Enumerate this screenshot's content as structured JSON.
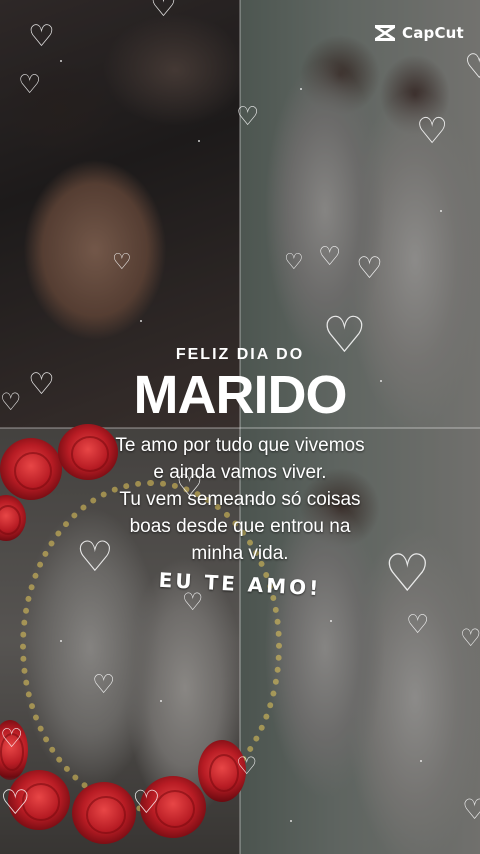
{
  "watermark": {
    "text": "CapCut",
    "icon": "capcut-logo-icon"
  },
  "title": {
    "line1": "FELIZ DIA DO",
    "line2": "MARIDO"
  },
  "message": {
    "lines": [
      "Te amo por tudo que vivemos",
      "e ainda vamos viver.",
      "Tu vem semeando só coisas",
      "boas desde que entrou na",
      "minha vida."
    ]
  },
  "closing": "EU TE AMO!",
  "decor": {
    "heart_icon": "heart-outline-icon",
    "rose_icon": "red-rose-icon",
    "accent_color": "#e8c85a",
    "rose_color": "#b81c24"
  }
}
